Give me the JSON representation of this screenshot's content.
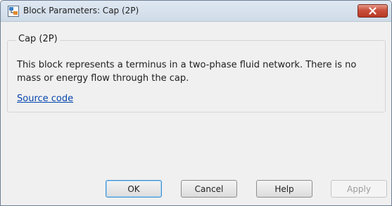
{
  "window": {
    "title": "Block Parameters: Cap (2P)"
  },
  "block": {
    "group_label": "Cap (2P)",
    "description": "This block represents a terminus in a two-phase fluid network. There is no mass or energy flow through the cap.",
    "source_link": "Source code"
  },
  "buttons": {
    "ok": "OK",
    "cancel": "Cancel",
    "help": "Help",
    "apply": "Apply"
  },
  "colors": {
    "link": "#0645ad",
    "close_button": "#c9503c",
    "default_button_border": "#3c8fd0"
  },
  "icons": {
    "app": "simulink-block-icon",
    "close": "close-icon"
  },
  "state": {
    "apply_enabled": false,
    "default_button": "ok"
  }
}
